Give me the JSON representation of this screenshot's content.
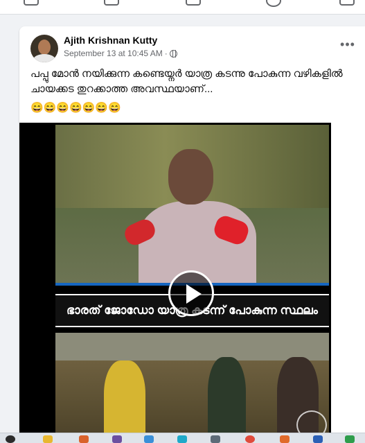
{
  "post": {
    "author": "Ajith Krishnan Kutty",
    "timestamp": "September 13 at 10:45 AM",
    "separator": "·",
    "more_label": "•••",
    "text": "പപ്പു മോൻ നയിക്കുന്ന കണ്ടെയ്നർ യാത്ര കടന്നു പോകുന്ന വഴികളിൽ ചായക്കട തുറക്കാത്ത അവസ്ഥയാണ്...",
    "emojis": "😄😄😄😄😄😄😄"
  },
  "video": {
    "caption": "ഭാരത് ജോഡോ യാത്ര കടന്ന് പോകുന്ന സ്ഥലം"
  },
  "colors": {
    "background": "#f0f2f5",
    "card": "#ffffff",
    "secondary_text": "#65676b",
    "video_bg": "#000000"
  }
}
